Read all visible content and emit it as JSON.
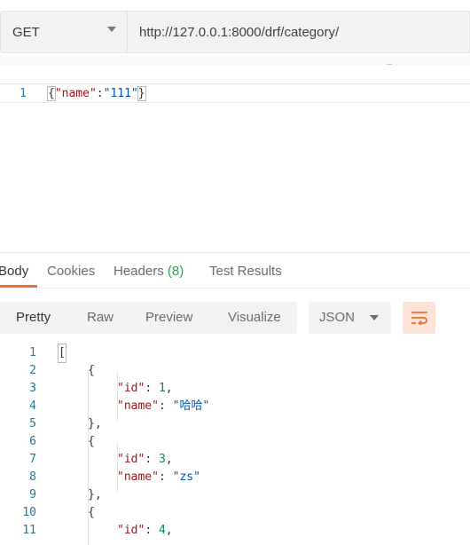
{
  "request": {
    "method": "GET",
    "url": "http://127.0.0.1:8000/drf/category/"
  },
  "request_body": {
    "line_number": "1",
    "open_brace": "{",
    "key": "\"name\"",
    "colon": ":",
    "value": "\"111\"",
    "close_brace": "}"
  },
  "response_tabs": [
    {
      "label": "Body"
    },
    {
      "label": "Cookies"
    },
    {
      "label": "Headers",
      "count": "(8)"
    },
    {
      "label": "Test Results"
    }
  ],
  "toolbar": {
    "view_modes": [
      "Pretty",
      "Raw",
      "Preview",
      "Visualize"
    ],
    "format": "JSON",
    "wrap_icon": "wrap-lines-icon",
    "accent_color": "#f26b3a"
  },
  "response_lines": [
    {
      "n": "1",
      "text": "["
    },
    {
      "n": "2",
      "text": "{"
    },
    {
      "n": "3",
      "key": "\"id\"",
      "num": "1",
      "tail": ","
    },
    {
      "n": "4",
      "key": "\"name\"",
      "str": "\"哈哈\""
    },
    {
      "n": "5",
      "text": "},"
    },
    {
      "n": "6",
      "text": "{"
    },
    {
      "n": "7",
      "key": "\"id\"",
      "num": "3",
      "tail": ","
    },
    {
      "n": "8",
      "key": "\"name\"",
      "str": "\"zs\""
    },
    {
      "n": "9",
      "text": "},"
    },
    {
      "n": "10",
      "text": "{"
    },
    {
      "n": "11",
      "key": "\"id\"",
      "num": "4",
      "tail": ","
    }
  ]
}
